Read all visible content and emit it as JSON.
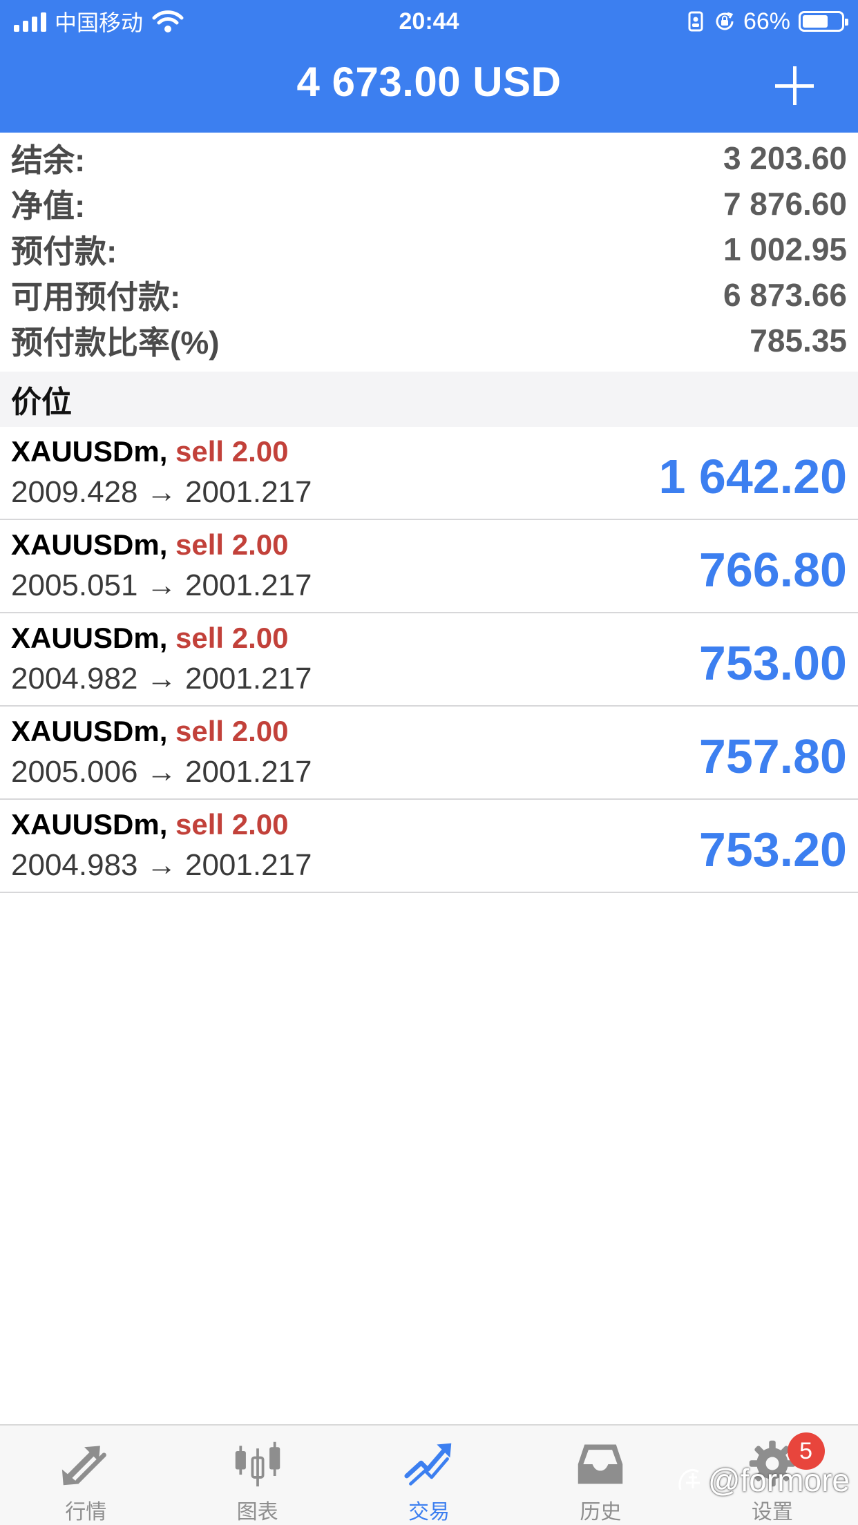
{
  "status": {
    "carrier": "中国移动",
    "time": "20:44",
    "battery_percent": "66%",
    "battery_level": 0.66
  },
  "nav": {
    "title": "4 673.00 USD"
  },
  "summary": [
    {
      "label": "结余:",
      "value": "3 203.60"
    },
    {
      "label": "净值:",
      "value": "7 876.60"
    },
    {
      "label": "预付款:",
      "value": "1 002.95"
    },
    {
      "label": "可用预付款:",
      "value": "6 873.66"
    },
    {
      "label": "预付款比率(%)",
      "value": "785.35"
    }
  ],
  "section_title": "价位",
  "positions": [
    {
      "symbol": "XAUUSDm,",
      "side": "sell 2.00",
      "prices": "2009.428 → 2001.217",
      "profit": "1 642.20"
    },
    {
      "symbol": "XAUUSDm,",
      "side": "sell 2.00",
      "prices": "2005.051 → 2001.217",
      "profit": "766.80"
    },
    {
      "symbol": "XAUUSDm,",
      "side": "sell 2.00",
      "prices": "2004.982 → 2001.217",
      "profit": "753.00"
    },
    {
      "symbol": "XAUUSDm,",
      "side": "sell 2.00",
      "prices": "2005.006 → 2001.217",
      "profit": "757.80"
    },
    {
      "symbol": "XAUUSDm,",
      "side": "sell 2.00",
      "prices": "2004.983 → 2001.217",
      "profit": "753.20"
    }
  ],
  "tabs": [
    {
      "label": "行情",
      "icon": "quotes-arrows-icon"
    },
    {
      "label": "图表",
      "icon": "candlestick-chart-icon"
    },
    {
      "label": "交易",
      "icon": "trade-trend-icon",
      "active": true
    },
    {
      "label": "历史",
      "icon": "history-inbox-icon"
    },
    {
      "label": "设置",
      "icon": "settings-gear-icon",
      "badge": "5"
    }
  ],
  "watermark": "@formore",
  "colors": {
    "primary": "#3c7ff0",
    "sell": "#c2413a",
    "badge": "#e8453c"
  }
}
